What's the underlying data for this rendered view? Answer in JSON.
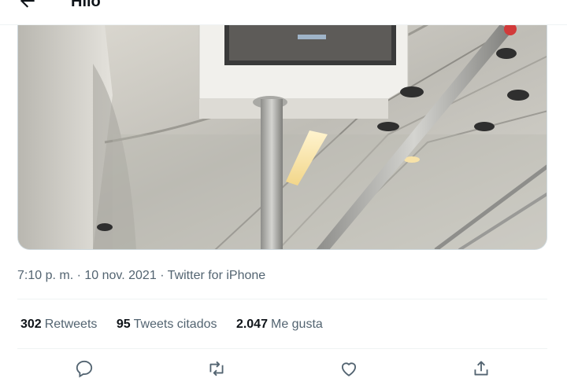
{
  "header": {
    "title": "Hilo",
    "back_icon": "arrow-left-icon"
  },
  "media": {
    "description_icon": "photo"
  },
  "tweet": {
    "time": "7:10 p. m.",
    "separator": "·",
    "date": "10 nov. 2021",
    "source": "Twitter for iPhone"
  },
  "stats": {
    "retweets_count": "302",
    "retweets_label": "Retweets",
    "quotes_count": "95",
    "quotes_label": "Tweets citados",
    "likes_count": "2.047",
    "likes_label": "Me gusta"
  },
  "actions": {
    "reply_icon": "reply-icon",
    "retweet_icon": "retweet-icon",
    "like_icon": "heart-icon",
    "share_icon": "share-icon"
  },
  "colors": {
    "text": "#0f1419",
    "secondary": "#536471",
    "divider": "#eff3f4"
  }
}
